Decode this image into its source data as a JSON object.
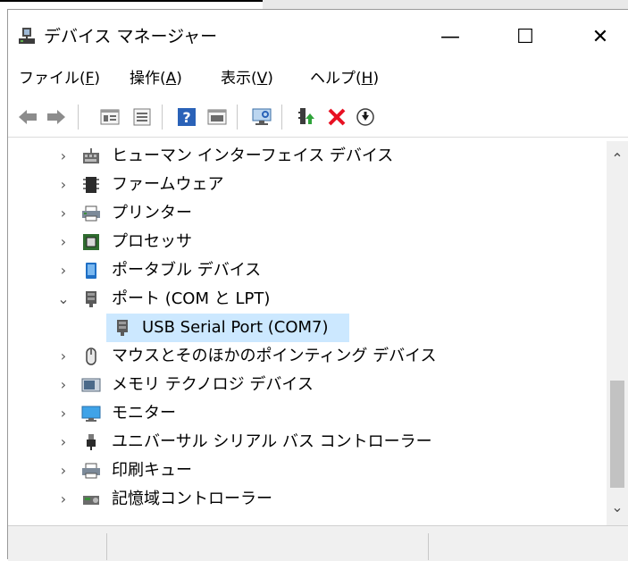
{
  "window": {
    "title": "デバイス マネージャー",
    "minimize_glyph": "—",
    "maximize_glyph": "☐",
    "close_glyph": "✕"
  },
  "menu": {
    "items": [
      {
        "label": "ファイル(",
        "accel": "F",
        "end": ")"
      },
      {
        "label": "操作(",
        "accel": "A",
        "end": ")"
      },
      {
        "label": "表示(",
        "accel": "V",
        "end": ")"
      },
      {
        "label": "ヘルプ(",
        "accel": "H",
        "end": ")"
      }
    ]
  },
  "toolbar": {
    "buttons": [
      "back-icon",
      "forward-icon",
      "properties-icon",
      "list-icon",
      "help-icon",
      "show-hidden-icon",
      "scan-hardware-icon",
      "update-driver-icon",
      "uninstall-icon",
      "disable-icon"
    ]
  },
  "tree": {
    "expand_glyph": "›",
    "collapse_glyph": "⌄",
    "items": [
      {
        "label": "ヒューマン インターフェイス デバイス",
        "icon": "hid-icon",
        "expanded": false
      },
      {
        "label": "ファームウェア",
        "icon": "firmware-icon",
        "expanded": false
      },
      {
        "label": "プリンター",
        "icon": "printer-icon",
        "expanded": false
      },
      {
        "label": "プロセッサ",
        "icon": "processor-icon",
        "expanded": false
      },
      {
        "label": "ポータブル デバイス",
        "icon": "portable-device-icon",
        "expanded": false
      },
      {
        "label": "ポート (COM と LPT)",
        "icon": "port-icon",
        "expanded": true
      },
      {
        "label": "USB Serial Port (COM7)",
        "icon": "port-icon",
        "child": true,
        "selected": true
      },
      {
        "label": "マウスとそのほかのポインティング デバイス",
        "icon": "mouse-icon",
        "expanded": false
      },
      {
        "label": "メモリ テクノロジ デバイス",
        "icon": "memory-icon",
        "expanded": false
      },
      {
        "label": "モニター",
        "icon": "monitor-icon",
        "expanded": false
      },
      {
        "label": "ユニバーサル シリアル バス コントローラー",
        "icon": "usb-icon",
        "expanded": false
      },
      {
        "label": "印刷キュー",
        "icon": "print-queue-icon",
        "expanded": false
      },
      {
        "label": "記憶域コントローラー",
        "icon": "storage-controller-icon",
        "expanded": false
      }
    ]
  },
  "scrollbar": {
    "up_glyph": "⌃",
    "down_glyph": "⌄"
  },
  "colors": {
    "selection": "#cce8ff",
    "accent": "#0078d7"
  }
}
